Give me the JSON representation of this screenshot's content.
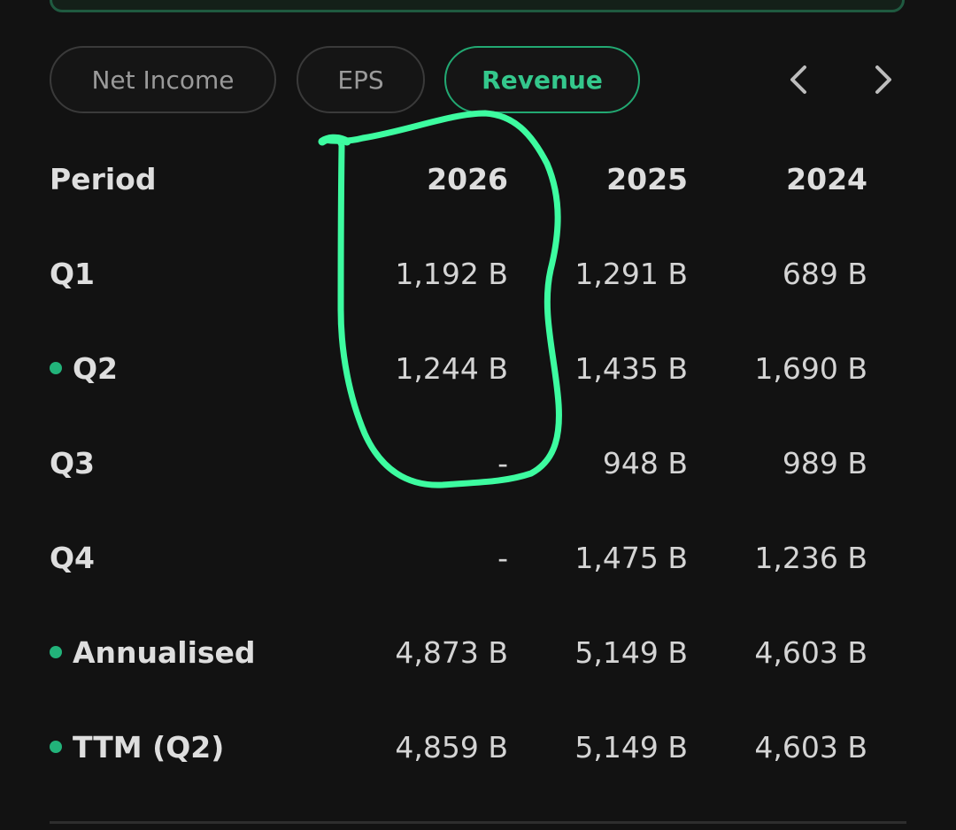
{
  "tabs": [
    {
      "label": "Net Income",
      "active": false
    },
    {
      "label": "EPS",
      "active": false
    },
    {
      "label": "Revenue",
      "active": true
    }
  ],
  "nav": {
    "prev_icon": "chevron-left-icon",
    "next_icon": "chevron-right-icon"
  },
  "table": {
    "header": {
      "label": "Period",
      "years": [
        "2026",
        "2025",
        "2024"
      ]
    },
    "rows": [
      {
        "label": "Q1",
        "dot": false,
        "values": [
          "1,192 B",
          "1,291 B",
          "689 B"
        ]
      },
      {
        "label": "Q2",
        "dot": true,
        "values": [
          "1,244 B",
          "1,435 B",
          "1,690 B"
        ]
      },
      {
        "label": "Q3",
        "dot": false,
        "values": [
          "-",
          "948 B",
          "989 B"
        ]
      },
      {
        "label": "Q4",
        "dot": false,
        "values": [
          "-",
          "1,475 B",
          "1,236 B"
        ]
      },
      {
        "label": "Annualised",
        "dot": true,
        "values": [
          "4,873 B",
          "5,149 B",
          "4,603 B"
        ]
      },
      {
        "label": "TTM (Q2)",
        "dot": true,
        "values": [
          "4,859 B",
          "5,149 B",
          "4,603 B"
        ]
      }
    ]
  },
  "colors": {
    "background": "#121212",
    "accent": "#22a872",
    "highlight_stroke": "#3dfca0"
  }
}
